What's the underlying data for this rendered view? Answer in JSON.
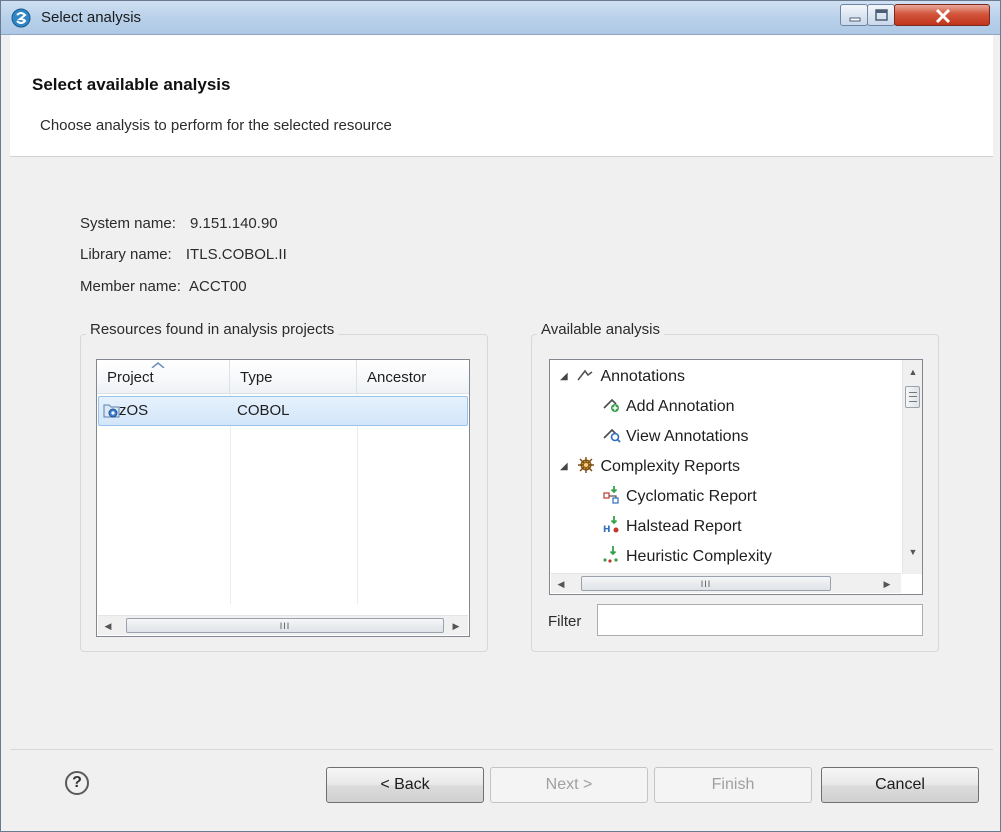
{
  "window": {
    "title": "Select analysis"
  },
  "header": {
    "title": "Select available analysis",
    "description": "Choose analysis to perform for the selected resource"
  },
  "info": {
    "system_label": "System name:",
    "system_value": "9.151.140.90",
    "library_label": "Library name:",
    "library_value": "ITLS.COBOL.II",
    "member_label": "Member name:",
    "member_value": "ACCT00"
  },
  "resources": {
    "group_label": "Resources found in analysis projects",
    "columns": [
      "Project",
      "Type",
      "Ancestor"
    ],
    "rows": [
      {
        "project": "zOS",
        "type": "COBOL",
        "ancestor": ""
      }
    ]
  },
  "analysis": {
    "group_label": "Available analysis",
    "items": [
      {
        "label": "Annotations",
        "level": 0,
        "expanded": true
      },
      {
        "label": "Add Annotation",
        "level": 1
      },
      {
        "label": "View Annotations",
        "level": 1
      },
      {
        "label": "Complexity Reports",
        "level": 0,
        "expanded": true
      },
      {
        "label": "Cyclomatic Report",
        "level": 1
      },
      {
        "label": "Halstead Report",
        "level": 1
      },
      {
        "label": "Heuristic Complexity",
        "level": 1
      }
    ],
    "filter_label": "Filter",
    "filter_value": ""
  },
  "footer": {
    "back_label": "< Back",
    "next_label": "Next >",
    "finish_label": "Finish",
    "cancel_label": "Cancel"
  },
  "icons": {
    "help": "question-circle-icon",
    "app": "app-icon"
  }
}
